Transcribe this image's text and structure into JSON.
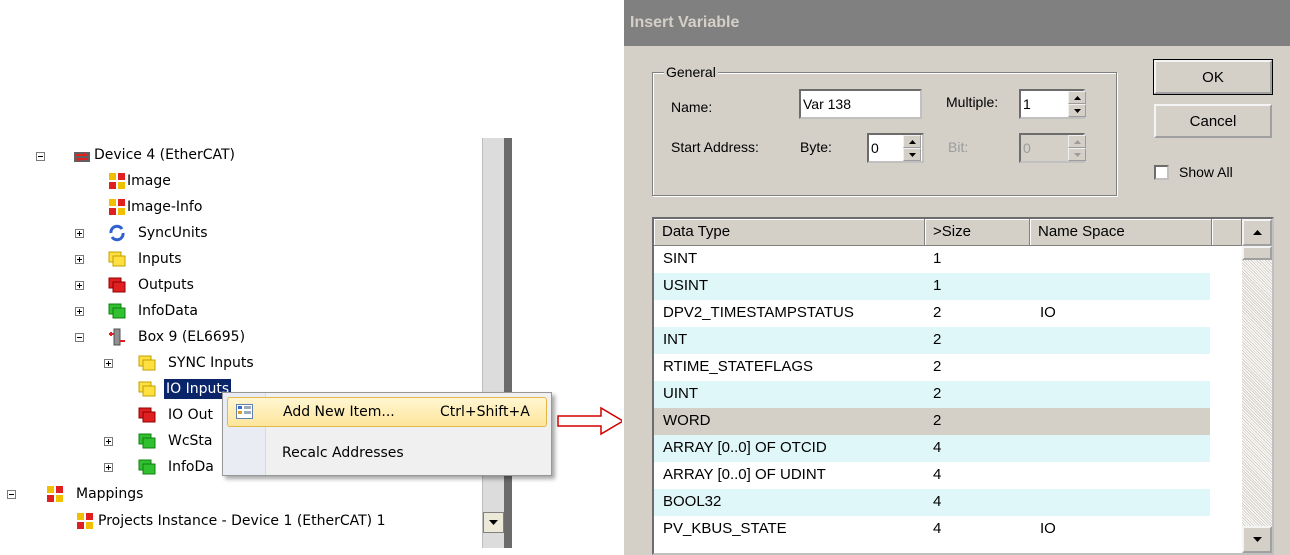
{
  "tree": {
    "items": [
      {
        "label": "Device 4 (EtherCAT)",
        "icon": "ethercat-device-icon"
      },
      {
        "label": "Image",
        "icon": "image-icon"
      },
      {
        "label": "Image-Info",
        "icon": "image-info-icon"
      },
      {
        "label": "SyncUnits",
        "icon": "sync-units-icon"
      },
      {
        "label": "Inputs",
        "icon": "inputs-icon"
      },
      {
        "label": "Outputs",
        "icon": "outputs-icon"
      },
      {
        "label": "InfoData",
        "icon": "infodata-icon"
      },
      {
        "label": "Box 9 (EL6695)",
        "icon": "box-terminal-icon"
      },
      {
        "label": "SYNC Inputs",
        "icon": "inputs-icon"
      },
      {
        "label": "IO Inputs",
        "icon": "inputs-icon"
      },
      {
        "label": "IO Out",
        "icon": "outputs-icon"
      },
      {
        "label": "WcSta",
        "icon": "infodata-icon"
      },
      {
        "label": "InfoDa",
        "icon": "infodata-icon"
      },
      {
        "label": "Mappings",
        "icon": "mappings-icon"
      },
      {
        "label": "Projects Instance - Device 1 (EtherCAT) 1",
        "icon": "mapping-instance-icon"
      }
    ]
  },
  "context_menu": {
    "items": [
      {
        "label": "Add New Item...",
        "shortcut": "Ctrl+Shift+A",
        "icon": "add-item-icon"
      },
      {
        "label": "Recalc Addresses",
        "shortcut": ""
      }
    ]
  },
  "dialog": {
    "title": "Insert Variable",
    "general_label": "General",
    "name_label": "Name:",
    "name_value": "Var 138",
    "multiple_label": "Multiple:",
    "multiple_value": "1",
    "start_address_label": "Start Address:",
    "byte_label": "Byte:",
    "byte_value": "0",
    "bit_label": "Bit:",
    "bit_value": "0",
    "ok_label": "OK",
    "cancel_label": "Cancel",
    "show_all_label": "Show All",
    "show_all_checked": false,
    "columns": [
      "Data Type",
      ">Size",
      "Name Space"
    ],
    "rows": [
      {
        "type": "SINT",
        "size": "1",
        "ns": ""
      },
      {
        "type": "USINT",
        "size": "1",
        "ns": ""
      },
      {
        "type": "DPV2_TIMESTAMPSTATUS",
        "size": "2",
        "ns": "IO"
      },
      {
        "type": "INT",
        "size": "2",
        "ns": ""
      },
      {
        "type": "RTIME_STATEFLAGS",
        "size": "2",
        "ns": ""
      },
      {
        "type": "UINT",
        "size": "2",
        "ns": ""
      },
      {
        "type": "WORD",
        "size": "2",
        "ns": ""
      },
      {
        "type": "ARRAY [0..0] OF OTCID",
        "size": "4",
        "ns": ""
      },
      {
        "type": "ARRAY [0..0] OF UDINT",
        "size": "4",
        "ns": ""
      },
      {
        "type": "BOOL32",
        "size": "4",
        "ns": ""
      },
      {
        "type": "PV_KBUS_STATE",
        "size": "4",
        "ns": "IO"
      }
    ],
    "selected_row": "WORD"
  },
  "colors": {
    "dialog_bg": "#d4d0c8",
    "title_bar": "#808080",
    "row_alt": "#dff7f9",
    "tree_selection": "#0a246a",
    "arrow": "#d40000"
  }
}
